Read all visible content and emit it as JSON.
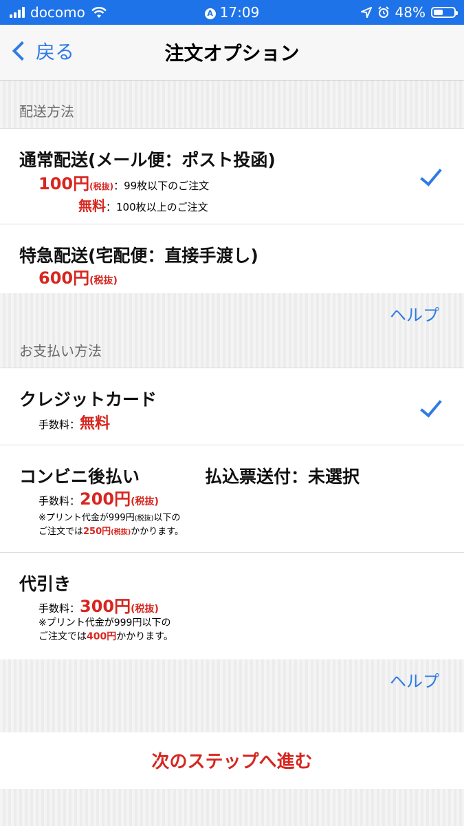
{
  "status": {
    "carrier": "docomo",
    "time": "17:09",
    "battery": "48%"
  },
  "nav": {
    "back_label": "戻る",
    "title": "注文オプション"
  },
  "shipping": {
    "section_label": "配送方法",
    "options": [
      {
        "title": "通常配送(メール便：ポスト投函)",
        "line1_price": "100円",
        "line1_tax": "(税抜)",
        "line1_note": "：99枚以下のご注文",
        "line2_price": "無料",
        "line2_note": "：100枚以上のご注文",
        "selected": true
      },
      {
        "title": "特急配送(宅配便：直接手渡し)",
        "price": "600円",
        "tax": "(税抜)",
        "selected": false
      }
    ],
    "help_label": "ヘルプ"
  },
  "payment": {
    "section_label": "お支払い方法",
    "options": [
      {
        "title": "クレジットカード",
        "fee_label": "手数料：",
        "fee": "無料",
        "selected": true
      },
      {
        "title": "コンビニ後払い",
        "extra": "払込票送付：未選択",
        "fee_label": "手数料：",
        "fee": "200円",
        "fee_tax": "(税抜)",
        "note1": "※プリント代金が999円",
        "note1_tax": "(税抜)",
        "note1_tail": "以下の",
        "note2_head": "ご注文では",
        "note2_price": "250円",
        "note2_tax": "(税抜)",
        "note2_tail": "かかります。"
      },
      {
        "title": "代引き",
        "fee_label": "手数料：",
        "fee": "300円",
        "fee_tax": "(税抜)",
        "note1": "※プリント代金が999円以下の",
        "note2_head": "ご注文では",
        "note2_price": "400円",
        "note2_tail": "かかります。"
      }
    ],
    "help_label": "ヘルプ"
  },
  "footer": {
    "next_label": "次のステップへ進む"
  },
  "colors": {
    "accent": "#2f7ae5",
    "status_bar": "#1f73e8",
    "price_red": "#d7261f"
  }
}
